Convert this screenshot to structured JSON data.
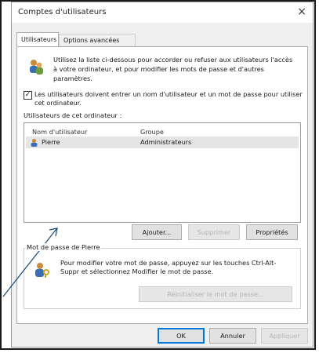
{
  "window": {
    "title": "Comptes d'utilisateurs",
    "close_label": "×"
  },
  "tabs": [
    {
      "label": "Utilisateurs"
    },
    {
      "label": "Options avancées"
    }
  ],
  "intro_text": "Utilisez la liste ci-dessous pour accorder ou refuser aux utilisateurs l'accès à votre ordinateur, et pour modifier les mots de passe et d'autres paramètres.",
  "require_password": {
    "checked": true,
    "check_glyph": "✓",
    "label": "Les utilisateurs doivent entrer un nom d'utilisateur et un mot de passe pour utiliser cet ordinateur."
  },
  "users_list": {
    "label": "Utilisateurs de cet ordinateur :",
    "columns": [
      "Nom d'utilisateur",
      "Groupe"
    ],
    "rows": [
      {
        "name": "Pierre",
        "group": "Administrateurs"
      }
    ]
  },
  "list_buttons": {
    "add": "Ajouter...",
    "remove": "Supprimer",
    "properties": "Propriétés"
  },
  "password_group": {
    "title": "Mot de passe de Pierre",
    "text": "Pour modifier votre mot de passe, appuyez sur les touches Ctrl-Alt-Suppr et sélectionnez Modifier le mot de passe.",
    "reset_button": "Réinitialiser le mot de passe..."
  },
  "dialog_buttons": {
    "ok": "OK",
    "cancel": "Annuler",
    "apply": "Appliquer"
  },
  "colors": {
    "accent": "#0078d7",
    "annotation_arrow": "#1f4e79"
  }
}
